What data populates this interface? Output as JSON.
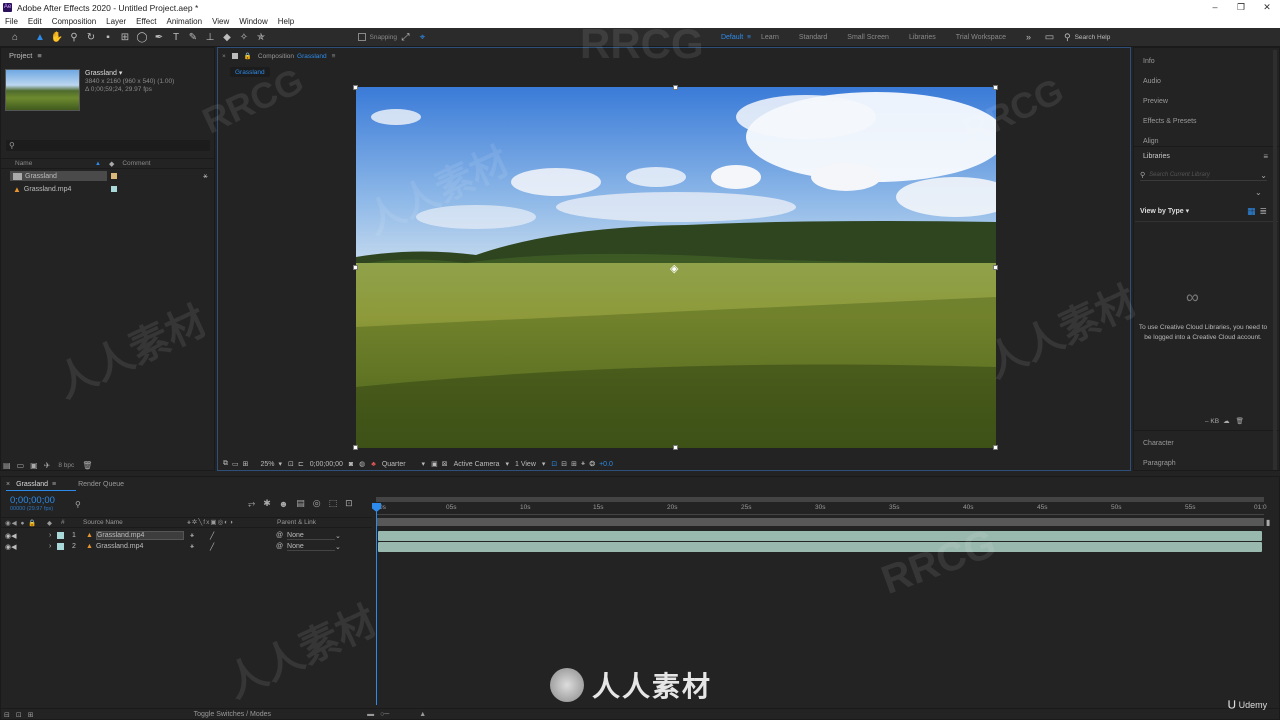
{
  "window": {
    "title": "Adobe After Effects 2020 - Untitled Project.aep *",
    "controls": [
      "–",
      "❐",
      "✕"
    ]
  },
  "menu": [
    "File",
    "Edit",
    "Composition",
    "Layer",
    "Effect",
    "Animation",
    "View",
    "Window",
    "Help"
  ],
  "toolbar": {
    "snapping_label": "Snapping",
    "workspaces": [
      "Default",
      "Learn",
      "Standard",
      "Small Screen",
      "Libraries",
      "Trial Workspace"
    ],
    "active_workspace": "Default",
    "overflow": "»",
    "search_label": "Search Help"
  },
  "project": {
    "tab_label": "Project",
    "item_name": "Grassland ▾",
    "item_info_1": "3840 x 2160  (960 x 540) (1.00)",
    "item_info_2": "Δ 0;00;59;24, 29.97 fps",
    "col_name": "Name",
    "col_comment": "Comment",
    "items": [
      {
        "name": "Grassland",
        "type": "composition"
      },
      {
        "name": "Grassland.mp4",
        "type": "footage"
      }
    ],
    "bpc_label": "8 bpc"
  },
  "composition": {
    "tab_label": "Composition",
    "tab_name": "Grassland",
    "breadcrumb": "Grassland",
    "zoom": "25%",
    "timecode": "0;00;00;00",
    "resolution": "Quarter",
    "camera": "Active Camera",
    "views": "1 View",
    "exposure": "+0.0"
  },
  "right_panels": {
    "items": [
      "Info",
      "Audio",
      "Preview",
      "Effects & Presets",
      "Align"
    ],
    "libraries_label": "Libraries",
    "search_placeholder": "Search Current Library",
    "view_by": "View by Type ▾",
    "message": "To use Creative Cloud Libraries, you need to be logged into a Creative Cloud account.",
    "size_label": "– KB",
    "bottom_items": [
      "Character",
      "Paragraph"
    ]
  },
  "timeline": {
    "tab_label": "Grassland",
    "render_queue": "Render Queue",
    "timecode": "0;00;00;00",
    "timecode_sub": "00000 (29.97 fps)",
    "col_num": "#",
    "col_source": "Source Name",
    "col_parent": "Parent & Link",
    "layers": [
      {
        "num": "1",
        "name": "Grassland.mp4",
        "parent": "None"
      },
      {
        "num": "2",
        "name": "Grassland.mp4",
        "parent": "None"
      }
    ],
    "ruler": [
      "0s",
      "05s",
      "10s",
      "15s",
      "20s",
      "25s",
      "30s",
      "35s",
      "40s",
      "45s",
      "50s",
      "55s",
      "01:0"
    ],
    "toggle_label": "Toggle Switches / Modes"
  },
  "watermarks": {
    "text_a": "RRCG",
    "text_b": "人人素材",
    "brand": "人人素材",
    "udemy": "Udemy"
  },
  "colors": {
    "accent": "#2d8ceb",
    "panel_bg": "#232323",
    "track": "#9ab9ae"
  }
}
